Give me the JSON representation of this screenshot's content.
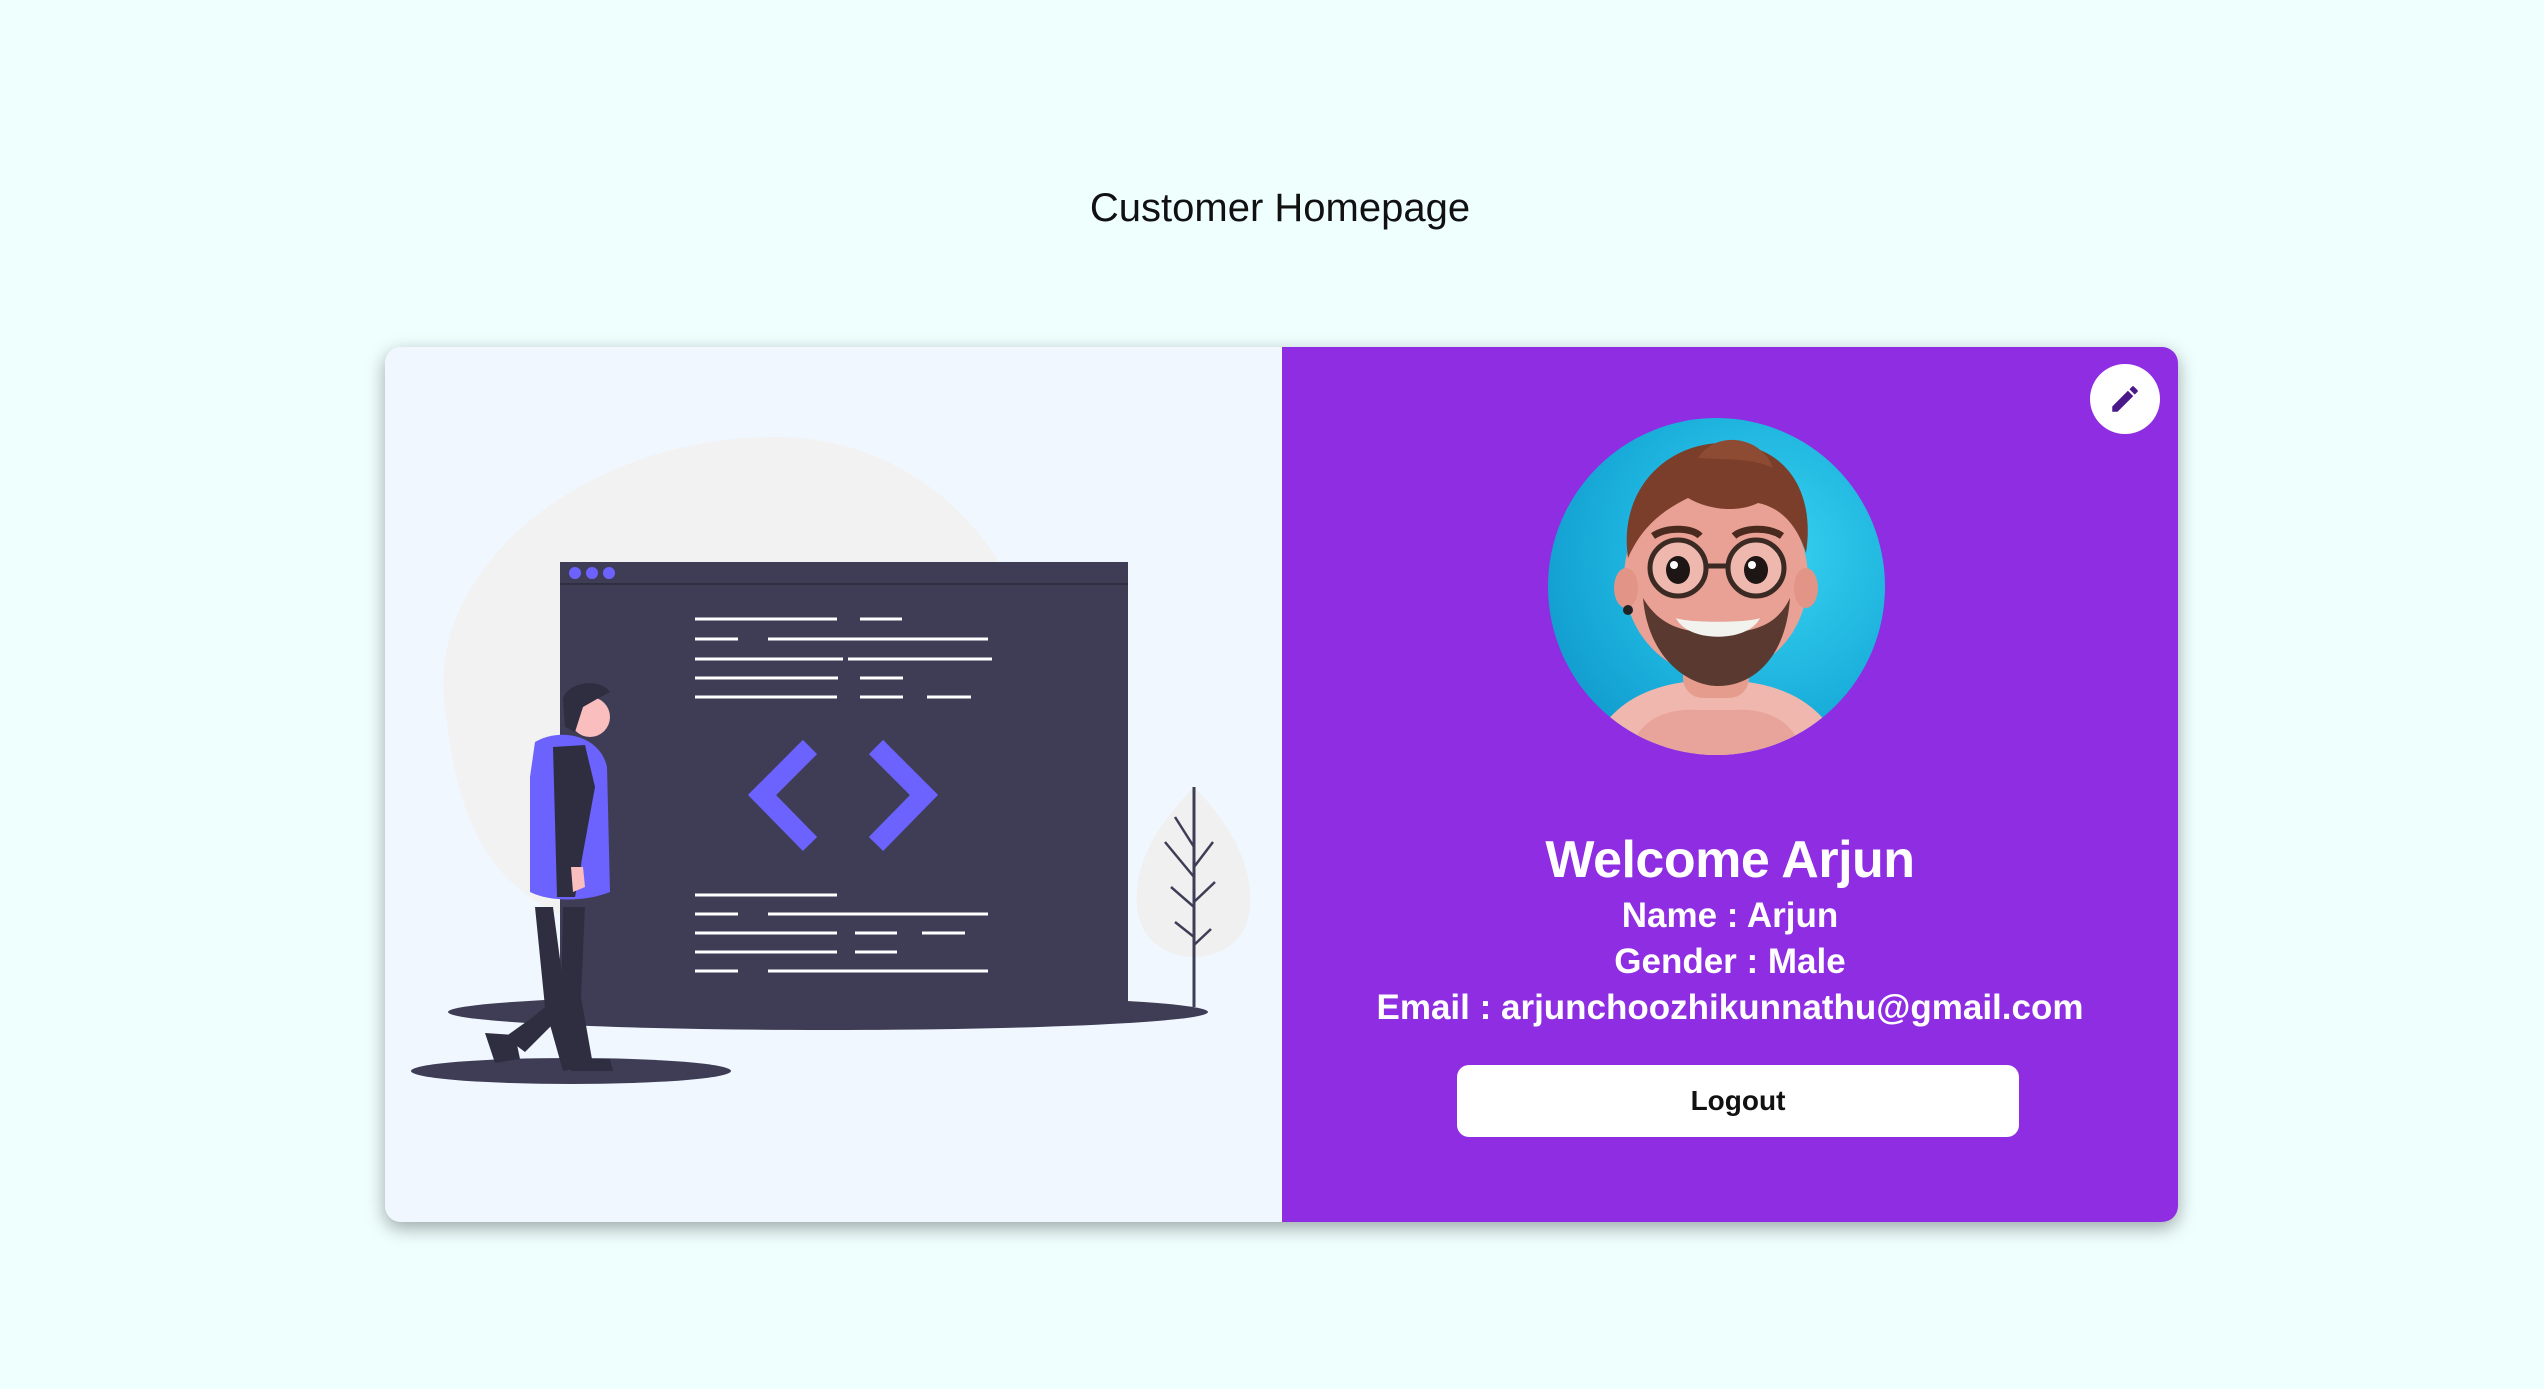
{
  "page": {
    "title": "Customer Homepage"
  },
  "profile": {
    "welcome": "Welcome Arjun",
    "name_line": "Name : Arjun",
    "gender_line": "Gender : Male",
    "email_line": "Email : arjunchoozhikunnathu@gmail.com"
  },
  "actions": {
    "logout_label": "Logout",
    "edit_icon": "pencil-icon"
  },
  "illustration": {
    "code_glyph": "< >"
  },
  "colors": {
    "page_background": "#effffe",
    "left_panel": "#f0f7ff",
    "right_panel": "#8e2de2",
    "illustration_accent": "#6c63ff",
    "illustration_dark": "#3f3d56"
  }
}
